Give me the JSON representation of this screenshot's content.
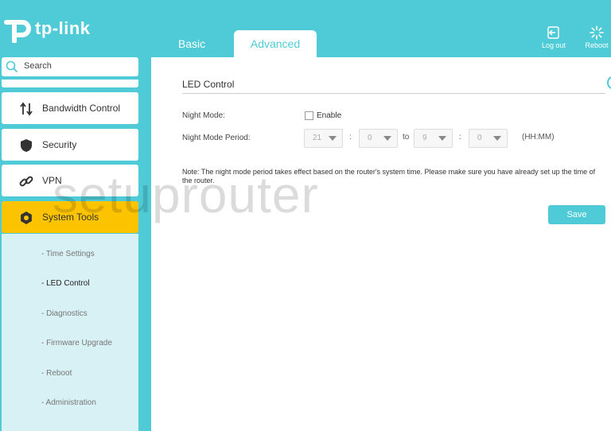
{
  "brand": {
    "name": "tp-link"
  },
  "tabs": {
    "basic": "Basic",
    "advanced": "Advanced"
  },
  "header": {
    "logout": "Log out",
    "reboot": "Reboot"
  },
  "sidebar": {
    "search_label": "Search",
    "items": [
      {
        "label": "Bandwidth Control",
        "icon": "arrows-updown-icon"
      },
      {
        "label": "Security",
        "icon": "shield-icon"
      },
      {
        "label": "VPN",
        "icon": "link-icon"
      },
      {
        "label": "System Tools",
        "icon": "gear-icon",
        "active": true
      }
    ],
    "subitems": [
      {
        "label": "- Time Settings"
      },
      {
        "label": "- LED Control",
        "current": true
      },
      {
        "label": "- Diagnostics"
      },
      {
        "label": "- Firmware Upgrade"
      },
      {
        "label": "- Reboot"
      },
      {
        "label": "- Administration"
      }
    ]
  },
  "main": {
    "title": "LED Control",
    "night_mode_label": "Night Mode:",
    "enable_label": "Enable",
    "enable_checked": false,
    "period_label": "Night Mode Period:",
    "start_hour": "21",
    "start_min": "0",
    "to_label": "to",
    "end_hour": "9",
    "end_min": "0",
    "colon": ":",
    "format": "(HH:MM)",
    "note": "Note: The night mode period takes effect based on the router's system time. Please make sure you have already set up the time of the router.",
    "save": "Save"
  },
  "watermark": "setuprouter",
  "colors": {
    "accent": "#4ecbd6",
    "active": "#fcc400"
  }
}
